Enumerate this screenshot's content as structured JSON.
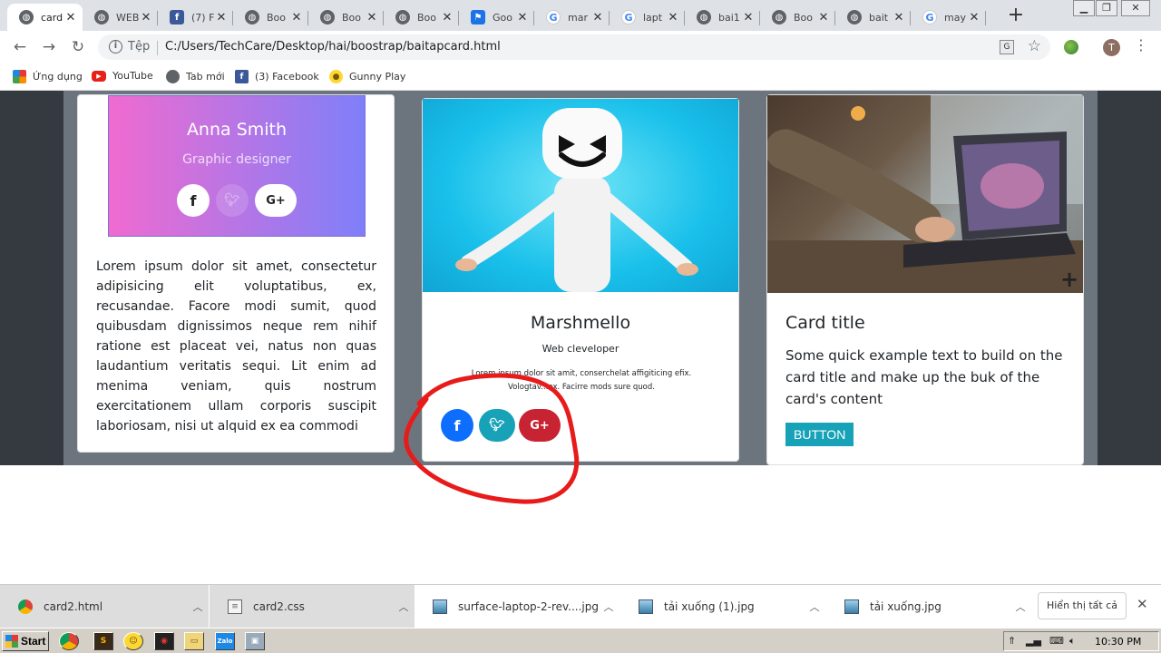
{
  "tabs": [
    {
      "label": "card",
      "icon": "globe",
      "active": true
    },
    {
      "label": "WEB",
      "icon": "globe"
    },
    {
      "label": "(7) F",
      "icon": "fb"
    },
    {
      "label": "Boo",
      "icon": "globe"
    },
    {
      "label": "Boo",
      "icon": "globe"
    },
    {
      "label": "Boo",
      "icon": "globe"
    },
    {
      "label": "Goo",
      "icon": "flag"
    },
    {
      "label": "mar",
      "icon": "g"
    },
    {
      "label": "lapt",
      "icon": "g"
    },
    {
      "label": "bai1",
      "icon": "globe"
    },
    {
      "label": "Boo",
      "icon": "globe"
    },
    {
      "label": "bait",
      "icon": "globe"
    },
    {
      "label": "may",
      "icon": "g"
    }
  ],
  "omnibox": {
    "scheme": "Tệp",
    "url": "C:/Users/TechCare/Desktop/hai/boostrap/baitapcard.html"
  },
  "bookmarks": [
    {
      "label": "Ứng dụng",
      "icon": "apps"
    },
    {
      "label": "YouTube",
      "icon": "youtube"
    },
    {
      "label": "Tab mới",
      "icon": "globe"
    },
    {
      "label": "(3) Facebook",
      "icon": "facebook"
    },
    {
      "label": "Gunny Play",
      "icon": "gunny"
    }
  ],
  "profile": {
    "initial": "T"
  },
  "cards": {
    "anna": {
      "name": "Anna Smith",
      "role": "Graphic designer",
      "socials": [
        "f",
        "",
        "G+"
      ],
      "lorem": "Lorem ipsum dolor sit amet, consectetur adipisicing elit voluptatibus, ex, recusandae. Facore modi sumit, quod quibusdam dignissimos neque rem nihif ratione est placeat vei, natus non quas laudantium veritatis sequi. Lit enim ad menima veniam, quis nostrum exercitationem ullam corporis suscipit laboriosam, nisi ut alquid ex ea commodi"
    },
    "marshmello": {
      "title": "Marshmello",
      "role": "Web cleveloper",
      "text": "Lorem ipsum dolor sit amit, conserchelat affigiticing efix. Vologtav...ex. Facirre mods sure quod.",
      "socials": [
        "f",
        "",
        "G+"
      ]
    },
    "laptop": {
      "title": "Card title",
      "text": "Some quick example text to build on the card title and make up the buk of the card's content",
      "button": "BUTTON"
    }
  },
  "annotation": {
    "color": "#e81b1b"
  },
  "downloads": [
    {
      "label": "card2.html",
      "icon": "chrome"
    },
    {
      "label": "card2.css",
      "icon": "file"
    },
    {
      "label": "surface-laptop-2-rev....jpg",
      "icon": "image"
    },
    {
      "label": "tải xuống (1).jpg",
      "icon": "image"
    },
    {
      "label": "tải xuống.jpg",
      "icon": "image"
    }
  ],
  "show_all_label": "Hiển thị tất cả",
  "taskbar": {
    "start": "Start",
    "clock": "10:30 PM"
  },
  "colors": {
    "facebook": "#0d6efd",
    "twitter": "#17a2b8",
    "google_plus": "#c82333",
    "card_button": "#17a2b8"
  }
}
